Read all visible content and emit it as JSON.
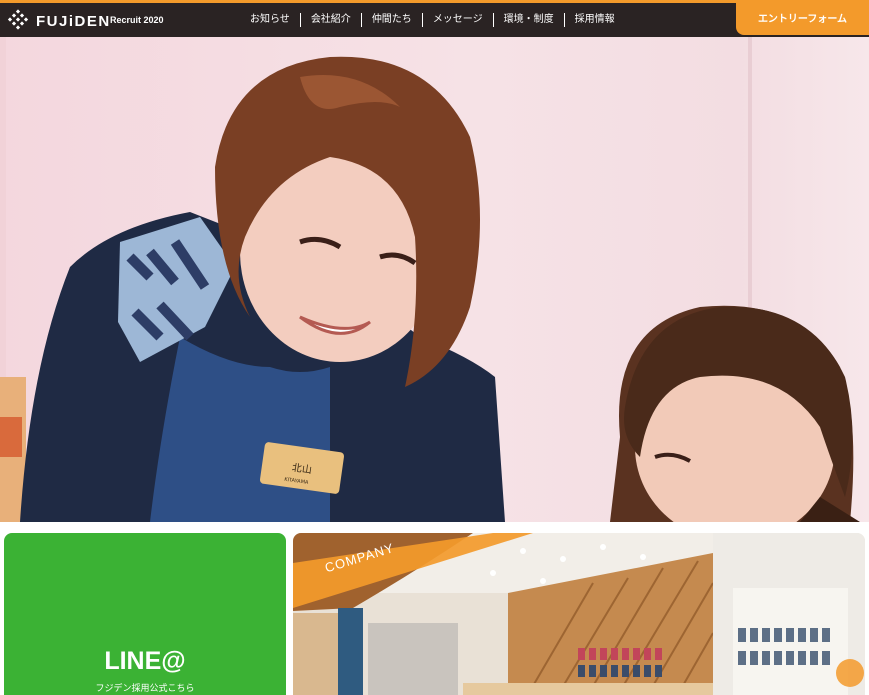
{
  "header": {
    "logo_text": "FUJiDEN",
    "recruit_label": "Recruit 2020",
    "nav": [
      {
        "label": "お知らせ"
      },
      {
        "label": "会社紹介"
      },
      {
        "label": "仲間たち"
      },
      {
        "label": "メッセージ"
      },
      {
        "label": "環境・制度"
      },
      {
        "label": "採用情報"
      }
    ],
    "entry_label": "エントリーフォーム"
  },
  "hero": {
    "badge_text": "北山",
    "badge_sub": "KITAYAMA"
  },
  "cards": {
    "line": {
      "logo_text": "LINE@",
      "caption": "フジデン採用公式こちら"
    },
    "company": {
      "label": "COMPANY"
    }
  },
  "colors": {
    "accent": "#f39a2b",
    "header_bg": "#2a2323",
    "line_green": "#3bb234"
  }
}
